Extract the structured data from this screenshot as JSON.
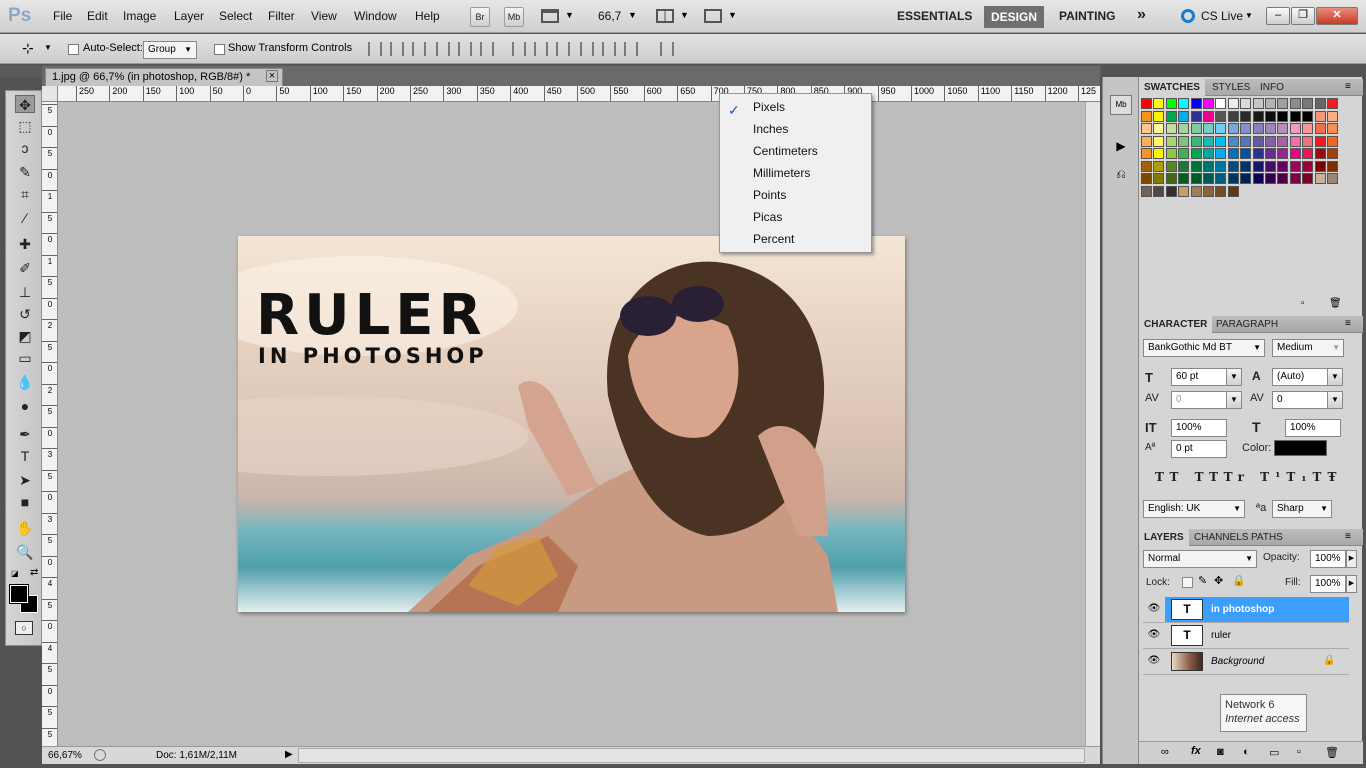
{
  "app": {
    "logo": "Ps"
  },
  "menu": [
    "File",
    "Edit",
    "Image",
    "Layer",
    "Select",
    "Filter",
    "View",
    "Window",
    "Help"
  ],
  "appbar": {
    "bridge": "Br",
    "minibridge": "Mb",
    "zoom": "66,7"
  },
  "workspaces": {
    "essentials": "ESSENTIALS",
    "design": "DESIGN",
    "painting": "PAINTING",
    "more": "»"
  },
  "cslive": "CS Live",
  "options": {
    "autoselect_label": "Auto-Select:",
    "autoselect_value": "Group",
    "transform_label": "Show Transform Controls"
  },
  "document": {
    "tab": "1.jpg @ 66,7% (in photoshop, RGB/8#) *",
    "close": "×"
  },
  "ruler_h": [
    "250",
    "200",
    "150",
    "100",
    "50",
    "0",
    "50",
    "100",
    "150",
    "200",
    "250",
    "300",
    "350",
    "400",
    "450",
    "500",
    "550",
    "600",
    "650",
    "700",
    "750",
    "800",
    "850",
    "900",
    "950",
    "1000",
    "1050",
    "1100",
    "1150",
    "1200",
    "125"
  ],
  "ruler_v": [
    "5",
    "0",
    "5",
    "0",
    "1",
    "5",
    "0",
    "1",
    "5",
    "0",
    "2",
    "5",
    "0",
    "2",
    "5",
    "0",
    "3",
    "5",
    "0",
    "3",
    "5",
    "0",
    "4",
    "5",
    "0",
    "4",
    "5",
    "0",
    "5",
    "5"
  ],
  "image": {
    "title": "RULER",
    "subtitle": "IN PHOTOSHOP"
  },
  "units_menu": {
    "items": [
      "Pixels",
      "Inches",
      "Centimeters",
      "Millimeters",
      "Points",
      "Picas",
      "Percent"
    ],
    "checked": "Pixels",
    "checkmark": "✓"
  },
  "status": {
    "zoom": "66,67%",
    "doc": "Doc: 1,61M/2,11M"
  },
  "swatches": {
    "tabs": [
      "SWATCHES",
      "STYLES",
      "INFO"
    ],
    "colors": [
      "#ff0000",
      "#ffff00",
      "#00ff00",
      "#00ffff",
      "#0000ff",
      "#ff00ff",
      "#ffffff",
      "#ececec",
      "#d9d9d9",
      "#c6c6c6",
      "#b3b3b3",
      "#a0a0a0",
      "#8c8c8c",
      "#797979",
      "#666666",
      "#ee1c25",
      "#f7941d",
      "#fff200",
      "#00a651",
      "#00aeef",
      "#2e3192",
      "#ec008c",
      "#555555",
      "#404040",
      "#2b2b2b",
      "#1a1a1a",
      "#0d0d0d",
      "#000000",
      "#000000",
      "#000000",
      "#f69679",
      "#f9ad81",
      "#fdc68a",
      "#fff79a",
      "#c4df9b",
      "#a2d39c",
      "#82ca9c",
      "#7accc8",
      "#6dcff6",
      "#7da7d9",
      "#8393ca",
      "#8781bd",
      "#a186be",
      "#bd8cbf",
      "#f49ac1",
      "#f5989d",
      "#f26c4f",
      "#f68e55",
      "#fbaf5d",
      "#fff467",
      "#acd372",
      "#7cc576",
      "#3bb878",
      "#1abbb4",
      "#00bff3",
      "#448ccb",
      "#5674b9",
      "#605ca8",
      "#855fa8",
      "#a763a8",
      "#f06eaa",
      "#f26d7d",
      "#ed1c24",
      "#f26522",
      "#f7941d",
      "#fff200",
      "#8dc63f",
      "#39b54a",
      "#00a651",
      "#00a99d",
      "#00aeef",
      "#0072bc",
      "#0054a6",
      "#2e3192",
      "#662d91",
      "#92278f",
      "#ec008c",
      "#ed145b",
      "#9e0b0f",
      "#a0410d",
      "#a36209",
      "#aba000",
      "#598527",
      "#1a7b30",
      "#007236",
      "#00746b",
      "#0076a3",
      "#004b80",
      "#003471",
      "#1b1464",
      "#440e62",
      "#630460",
      "#9e005d",
      "#9e0039",
      "#790000",
      "#7b2e00",
      "#7d4900",
      "#827b00",
      "#406618",
      "#005e20",
      "#005826",
      "#005952",
      "#005b7f",
      "#003663",
      "#002157",
      "#0d004c",
      "#32004b",
      "#4b0049",
      "#7b0046",
      "#7a0026",
      "#c7b299",
      "#998675",
      "#736357",
      "#534741",
      "#37302a",
      "#c69c6d",
      "#a67c52",
      "#8c6239",
      "#754c24",
      "#603913"
    ]
  },
  "character": {
    "tabs": [
      "CHARACTER",
      "PARAGRAPH"
    ],
    "font": "BankGothic Md BT",
    "style": "Medium",
    "size": "60 pt",
    "leading": "(Auto)",
    "kerning": "0",
    "tracking": "0",
    "vscale": "100%",
    "hscale": "100%",
    "baseline": "0 pt",
    "color_label": "Color:",
    "language": "English: UK",
    "aa": "Sharp",
    "aa_icon": "ªa"
  },
  "layers": {
    "tabs": [
      "LAYERS",
      "CHANNELS",
      "PATHS"
    ],
    "blend": "Normal",
    "opacity_label": "Opacity:",
    "opacity": "100%",
    "lock_label": "Lock:",
    "fill_label": "Fill:",
    "fill": "100%",
    "items": [
      {
        "name": "in photoshop",
        "type": "T",
        "selected": true
      },
      {
        "name": "ruler",
        "type": "T"
      },
      {
        "name": "Background",
        "type": "img"
      }
    ]
  },
  "tooltip": {
    "line1": "Network  6",
    "line2": "Internet access"
  }
}
